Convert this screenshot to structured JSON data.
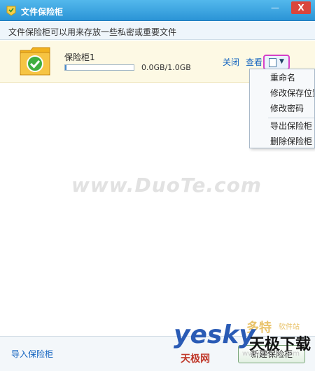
{
  "window": {
    "title": "文件保险柜",
    "min_glyph": "—",
    "close_glyph": "X"
  },
  "subheader": "文件保险柜可以用来存放一些私密或重要文件",
  "vault": {
    "name": "保险柜1",
    "size": "0.0GB/1.0GB",
    "progress": 0.02,
    "close_label": "关闭",
    "view_label": "查看",
    "more_caret": "▼"
  },
  "menu": {
    "items": [
      "重命名",
      "修改保存位置",
      "修改密码",
      "导出保险柜",
      "删除保险柜"
    ]
  },
  "watermark": "www.DuoTe.com",
  "footer": {
    "import_label": "导入保险柜",
    "new_label": "新建保险柜"
  },
  "logos": {
    "yesky": "yesky",
    "cn_name": "天极下载",
    "cn_sub": "天极网",
    "duote": "多特",
    "duote_sub": "软件站",
    "url": "www.DuoTe.com"
  },
  "colors": {
    "titlebar": "#2b94d6",
    "accent": "#d640c8",
    "link": "#1565c0"
  }
}
